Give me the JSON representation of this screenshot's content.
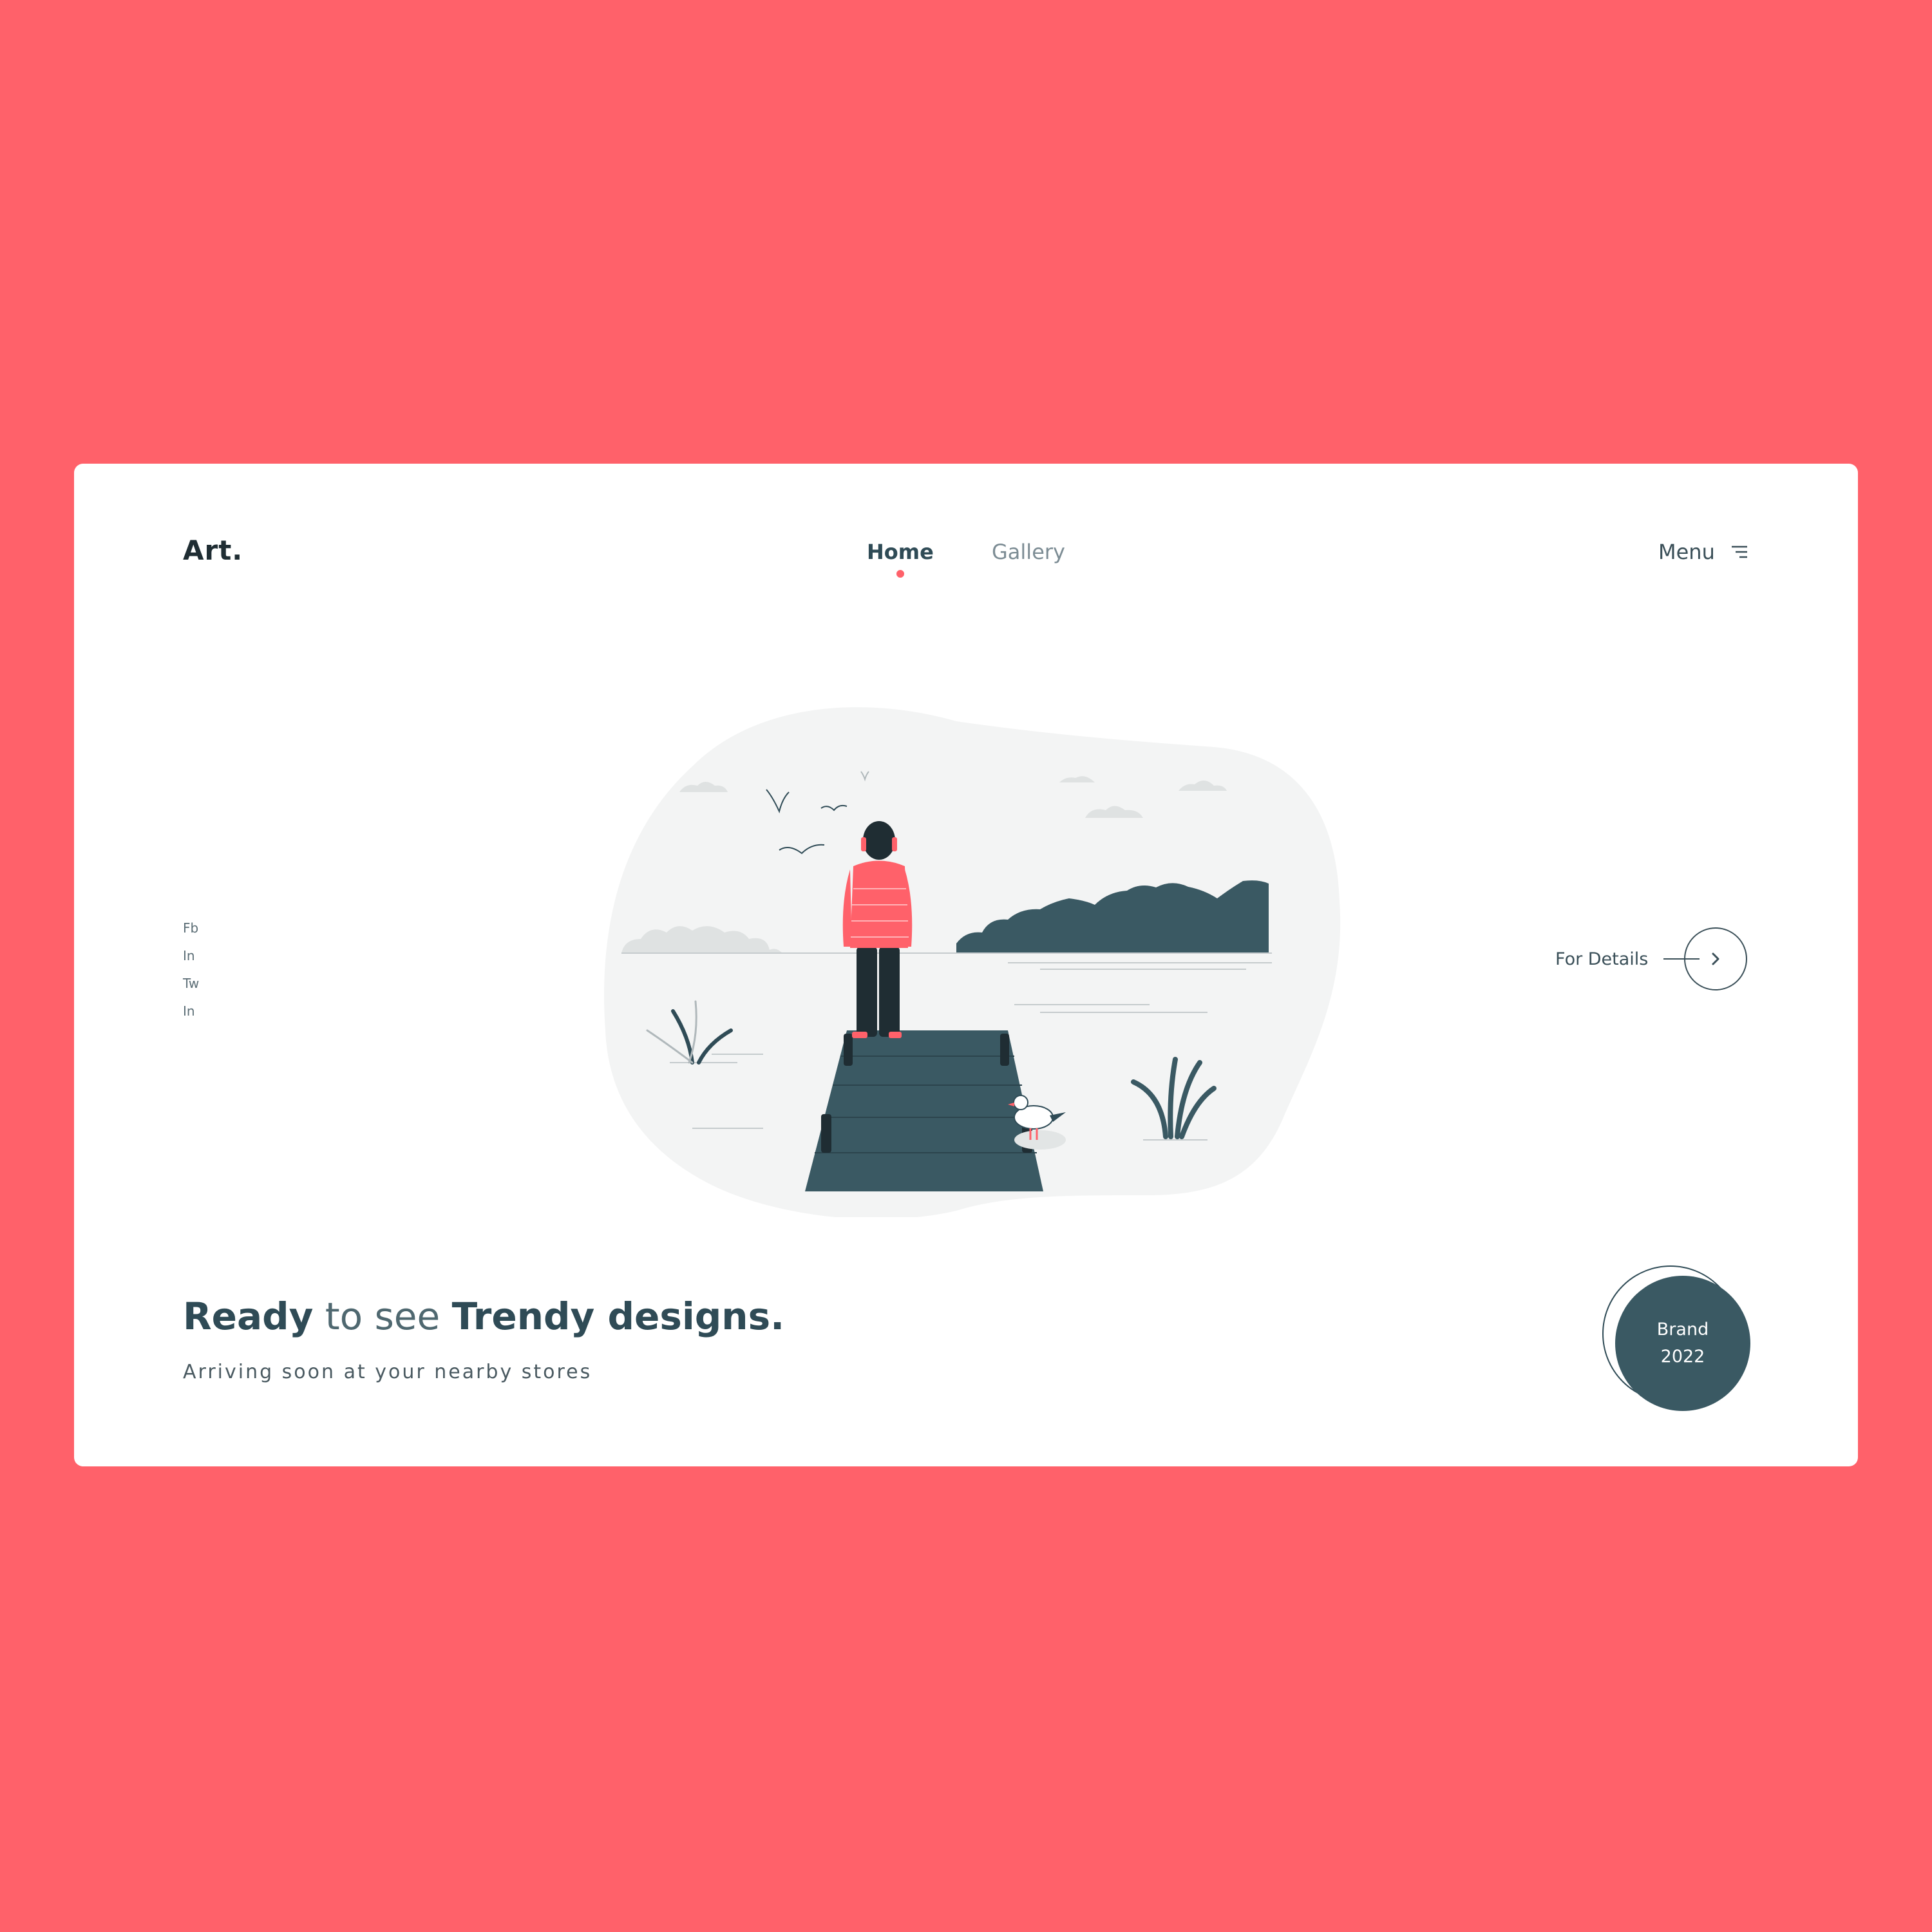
{
  "colors": {
    "background": "#ff616a",
    "card": "#ffffff",
    "primary_dark": "#2f4b56",
    "accent": "#ff616a",
    "muted": "#7c8c94"
  },
  "header": {
    "logo": "Art.",
    "nav": [
      {
        "label": "Home",
        "active": true
      },
      {
        "label": "Gallery",
        "active": false
      }
    ],
    "menu_label": "Menu",
    "menu_icon": "hamburger-menu-icon"
  },
  "social": [
    "Fb",
    "In",
    "Tw",
    "In"
  ],
  "details": {
    "label": "For Details",
    "icon": "chevron-right-icon"
  },
  "hero": {
    "headline_part1": "Ready",
    "headline_part2": " to see ",
    "headline_part3": "Trendy designs.",
    "subline": "Arriving soon at your nearby stores"
  },
  "badge": {
    "line1": "Brand",
    "line2": "2022"
  }
}
